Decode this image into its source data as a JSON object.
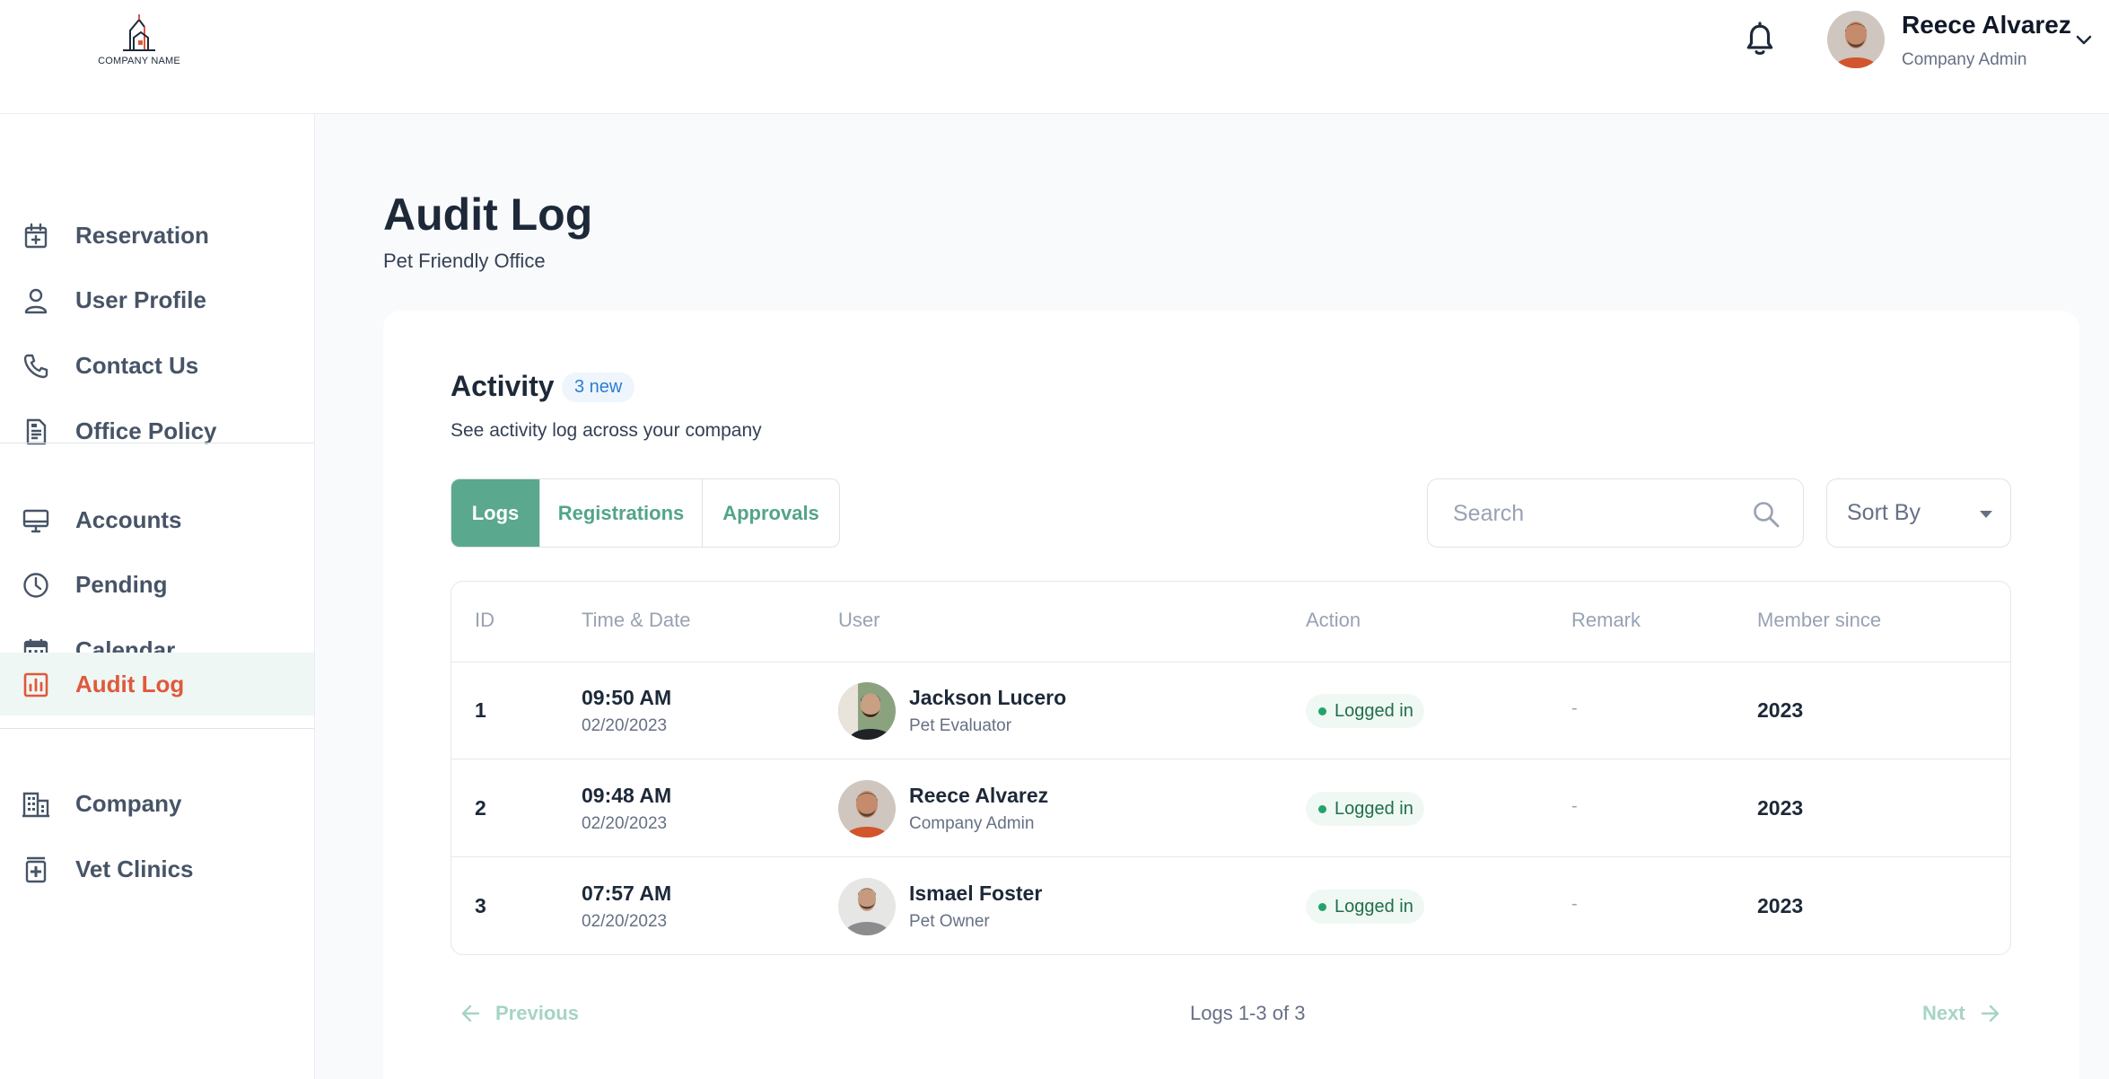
{
  "header": {
    "logo_text": "COMPANY NAME",
    "user": {
      "name": "Reece Alvarez",
      "role": "Company Admin"
    }
  },
  "sidebar": {
    "items": [
      {
        "label": "Reservation",
        "icon": "calendar-plus-icon"
      },
      {
        "label": "User Profile",
        "icon": "user-icon"
      },
      {
        "label": "Contact Us",
        "icon": "phone-icon"
      },
      {
        "label": "Office Policy",
        "icon": "document-icon"
      },
      {
        "label": "Accounts",
        "icon": "monitor-icon"
      },
      {
        "label": "Pending",
        "icon": "clock-icon"
      },
      {
        "label": "Calendar",
        "icon": "calendar-icon"
      },
      {
        "label": "Audit Log",
        "icon": "bar-chart-icon",
        "active": true
      },
      {
        "label": "Company",
        "icon": "building-icon"
      },
      {
        "label": "Vet Clinics",
        "icon": "medical-icon"
      }
    ]
  },
  "page": {
    "title": "Audit Log",
    "subtitle": "Pet Friendly Office"
  },
  "activity": {
    "title": "Activity",
    "badge": "3 new",
    "subtitle": "See activity log across your company",
    "tabs": [
      {
        "label": "Logs",
        "active": true
      },
      {
        "label": "Registrations",
        "active": false
      },
      {
        "label": "Approvals",
        "active": false
      }
    ],
    "search_placeholder": "Search",
    "sort_label": "Sort By"
  },
  "table": {
    "columns": [
      "ID",
      "Time & Date",
      "User",
      "Action",
      "Remark",
      "Member since"
    ],
    "rows": [
      {
        "id": "1",
        "time": "09:50 AM",
        "date": "02/20/2023",
        "user_name": "Jackson Lucero",
        "user_role": "Pet Evaluator",
        "action": "Logged in",
        "remark": "-",
        "member_since": "2023"
      },
      {
        "id": "2",
        "time": "09:48 AM",
        "date": "02/20/2023",
        "user_name": "Reece Alvarez",
        "user_role": "Company Admin",
        "action": "Logged in",
        "remark": "-",
        "member_since": "2023"
      },
      {
        "id": "3",
        "time": "07:57 AM",
        "date": "02/20/2023",
        "user_name": "Ismael Foster",
        "user_role": "Pet Owner",
        "action": "Logged in",
        "remark": "-",
        "member_since": "2023"
      }
    ]
  },
  "pagination": {
    "previous": "Previous",
    "next": "Next",
    "summary": "Logs 1-3 of 3"
  },
  "colors": {
    "accent_green": "#5aa88e",
    "active_nav_text": "#e0583b",
    "status_green": "#22a36b"
  }
}
